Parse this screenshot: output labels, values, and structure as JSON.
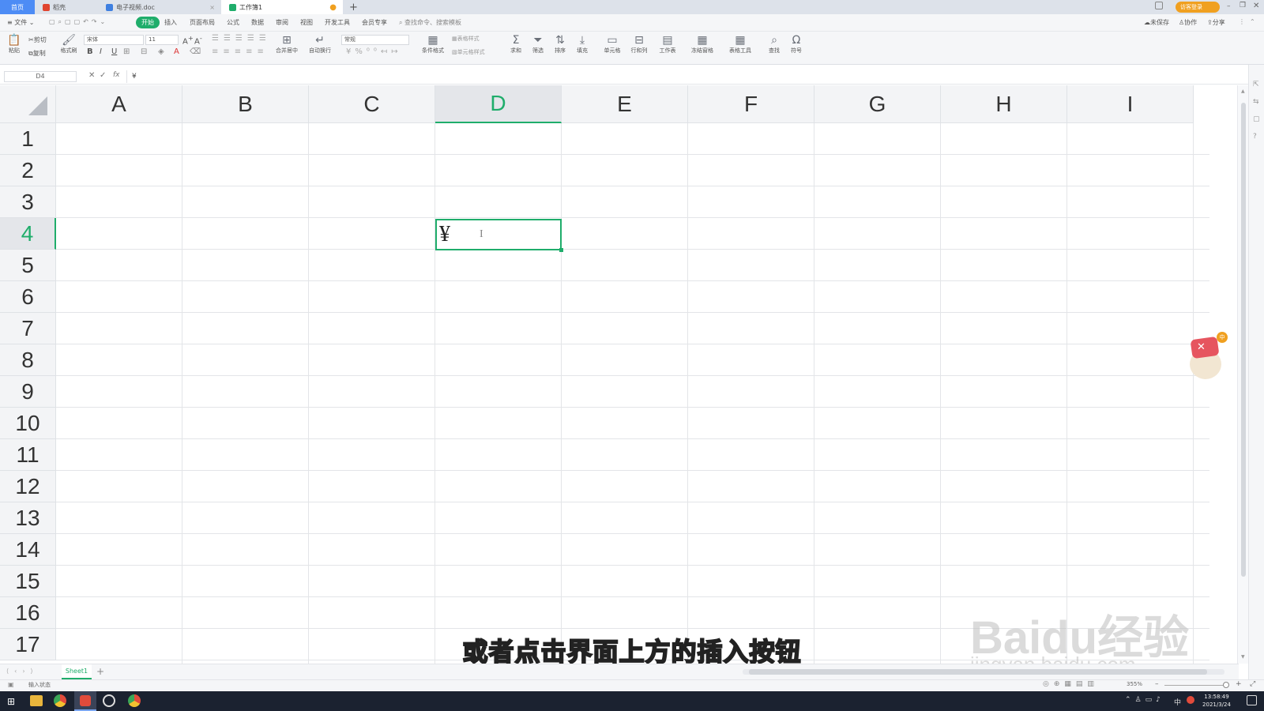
{
  "title_bar": {
    "tabs": [
      {
        "label": "首页",
        "active": false
      },
      {
        "label": "稻壳",
        "active": false
      },
      {
        "label": "电子视频.doc",
        "active": false
      },
      {
        "label": "工作簿1",
        "active": true
      }
    ],
    "login_label": "访客登录"
  },
  "menu": {
    "file_label": "文件",
    "items": [
      "开始",
      "插入",
      "页面布局",
      "公式",
      "数据",
      "审阅",
      "视图",
      "开发工具",
      "会员专享"
    ],
    "search_placeholder": "查找命令、搜索模板",
    "right": [
      "未保存",
      "协作",
      "分享"
    ]
  },
  "ribbon": {
    "paste": "粘贴",
    "cut": "剪切",
    "copy": "复制",
    "format_painter": "格式刷",
    "font_name": "宋体",
    "font_size": "11",
    "number_format": "常规",
    "merge": "合并居中",
    "wrap": "自动换行",
    "conditional": "条件格式",
    "table_style": "表格样式",
    "cell_style": "单元格样式",
    "sum": "求和",
    "filter": "筛选",
    "sort": "排序",
    "fill": "填充",
    "cell": "单元格",
    "rowcol": "行和列",
    "sheet": "工作表",
    "freeze": "冻结窗格",
    "tools": "表格工具",
    "find": "查找",
    "symbol": "符号"
  },
  "formula_bar": {
    "name_box": "D4",
    "content": "¥"
  },
  "grid": {
    "columns": [
      "A",
      "B",
      "C",
      "D",
      "E",
      "F",
      "G",
      "H",
      "I"
    ],
    "rows": [
      "1",
      "2",
      "3",
      "4",
      "5",
      "6",
      "7",
      "8",
      "9",
      "10",
      "11",
      "12",
      "13",
      "14",
      "15",
      "16",
      "17"
    ],
    "active_column": "D",
    "active_row": "4",
    "active_cell_value": "¥"
  },
  "sheets": {
    "tabs": [
      "Sheet1"
    ]
  },
  "status": {
    "mode": "输入状态",
    "zoom": "355%"
  },
  "overlay": {
    "subtitle": "或者点击界面上方的插入按钮",
    "watermark_top": "Baidu经验",
    "watermark_bottom": "jingyan.baidu.com"
  },
  "taskbar": {
    "time": "13:58:49",
    "date": "2021/3/24",
    "ime": "中"
  },
  "colors": {
    "accent": "#1fad6b",
    "titlebar": "#dde2ea",
    "taskbar": "#1b2230"
  }
}
